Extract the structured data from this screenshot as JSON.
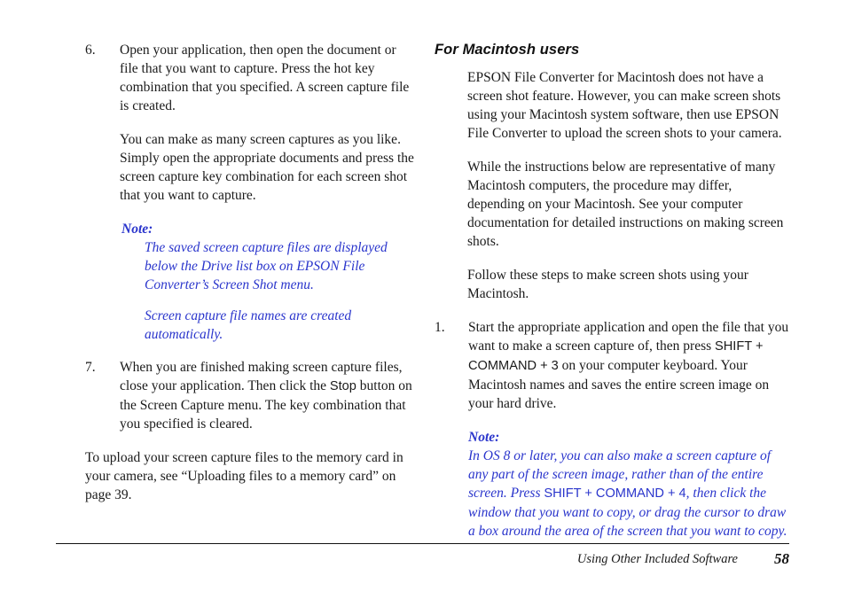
{
  "document": {
    "background_color": "#ffffff",
    "note_color": "#2a35cc",
    "text_color": "#1a1a1a"
  },
  "left_column": {
    "step_6": {
      "number": "6.",
      "paragraph_1": "Open your application, then open the document or file that you want to capture. Press the hot key combination that you specified. A screen capture file is created.",
      "paragraph_2": "You can make as many screen captures as you like. Simply open the appropriate documents and press the screen capture key combination for each screen shot that you want to capture."
    },
    "note_1": {
      "label": "Note:",
      "paragraph_1": "The saved screen capture files are displayed below the Drive list box on EPSON File Converter’s Screen Shot menu.",
      "paragraph_2": "Screen capture file names are created automatically."
    },
    "step_7": {
      "number": "7.",
      "text_before_button": "When you are finished making screen capture files, close your application. Then click the ",
      "button_name": "Stop",
      "text_after_button": " button on the Screen Capture menu. The key combination that you specified is cleared."
    },
    "closing_paragraph": "To upload your screen capture files to the memory card in your camera, see “Uploading files to a memory card” on page 39."
  },
  "right_column": {
    "heading": "For Macintosh users",
    "paragraph_1": "EPSON File Converter for Macintosh does not have a screen shot feature. However, you can make screen shots using your Macintosh system software, then use EPSON File Converter to upload the screen shots to your camera.",
    "paragraph_2": "While the instructions below are representative of many Macintosh computers, the procedure may differ, depending on your Macintosh. See your computer documentation for detailed instructions on making screen shots.",
    "paragraph_3": "Follow these steps to make screen shots using your Macintosh.",
    "step_1": {
      "number": "1.",
      "text_before_keys": "Start the appropriate application and open the file that you want to make a screen capture of, then press ",
      "keys": "SHIFT + COMMAND + 3",
      "text_after_keys": " on your computer keyboard. Your Macintosh names and saves the entire screen image on your hard drive."
    },
    "note_2": {
      "label": "Note:",
      "text_before_keys": "In OS 8 or later, you can also make a screen capture of any part of the screen image, rather than of the entire screen. Press ",
      "keys": "SHIFT + COMMAND + 4",
      "text_after_keys": ", then click the window that you want to copy, or drag the cursor to draw a box around the area of the screen that you want to copy."
    }
  },
  "footer": {
    "title": "Using Other Included Software",
    "page_number": "58"
  }
}
